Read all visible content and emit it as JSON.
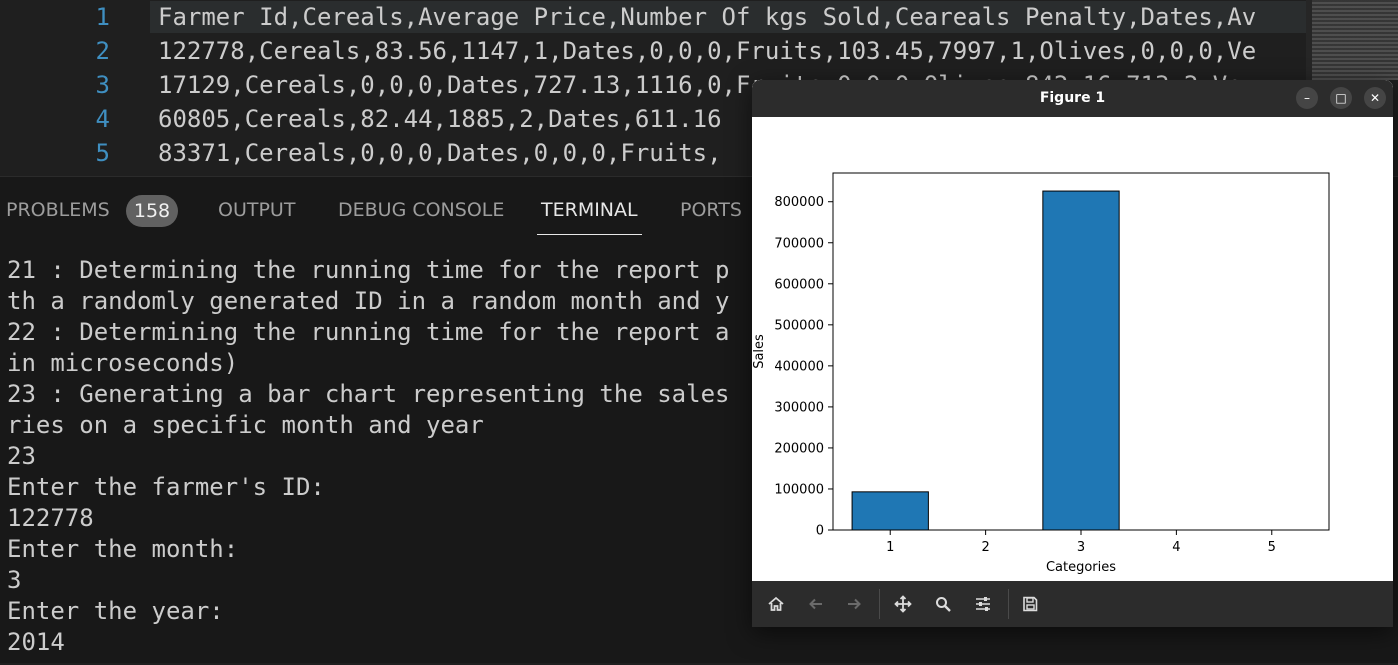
{
  "editor": {
    "lines": [
      {
        "no": "1",
        "text": "Farmer Id,Cereals,Average Price,Number Of kgs Sold,Ceareals Penalty,Dates,Av"
      },
      {
        "no": "2",
        "text": "122778,Cereals,83.56,1147,1,Dates,0,0,0,Fruits,103.45,7997,1,Olives,0,0,0,Ve"
      },
      {
        "no": "3",
        "text": "17129,Cereals,0,0,0,Dates,727.13,1116,0,Fruits,0,0,0,Olives,842.16,713,2,Ve"
      },
      {
        "no": "4",
        "text": "60805,Cereals,82.44,1885,2,Dates,611.16"
      },
      {
        "no": "5",
        "text": "83371,Cereals,0,0,0,Dates,0,0,0,Fruits,"
      }
    ]
  },
  "panel": {
    "tabs": [
      {
        "label": "PROBLEMS",
        "badge": "158"
      },
      {
        "label": "OUTPUT"
      },
      {
        "label": "DEBUG CONSOLE"
      },
      {
        "label": "TERMINAL"
      },
      {
        "label": "PORTS"
      }
    ],
    "active_tab": "TERMINAL"
  },
  "terminal": {
    "lines": [
      "21 : Determining the running time for the report p",
      "th a randomly generated ID in a random month and y",
      "22 : Determining the running time for the report a",
      "in microseconds)",
      "23 : Generating a bar chart representing the sales",
      "ries on a specific month and year",
      "23",
      "Enter the farmer's ID:",
      "122778",
      "Enter the month:",
      "3",
      "Enter the year:",
      "2014"
    ]
  },
  "figure": {
    "title": "Figure 1",
    "controls": {
      "minimize": "–",
      "maximize": "□",
      "close": "✕"
    },
    "toolbar_icons": [
      "home-icon",
      "back-arrow-icon",
      "forward-arrow-icon",
      "pan-icon",
      "zoom-icon",
      "configure-subplots-icon",
      "save-icon"
    ]
  },
  "chart_data": {
    "type": "bar",
    "categories": [
      "1",
      "2",
      "3",
      "4",
      "5"
    ],
    "values": [
      93000,
      0,
      826000,
      0,
      0
    ],
    "xlabel": "Categories",
    "ylabel": "Sales",
    "ylim": [
      0,
      870000
    ],
    "yticks": [
      "0",
      "100000",
      "200000",
      "300000",
      "400000",
      "500000",
      "600000",
      "700000",
      "800000"
    ],
    "bar_color": "#1f77b4",
    "edge_color": "#000000",
    "grid": false
  },
  "colors": {
    "editor_bg": "#1f1f1f",
    "panel_bg": "#181818",
    "line_number": "#3f8fc1",
    "text": "#cccccc"
  }
}
